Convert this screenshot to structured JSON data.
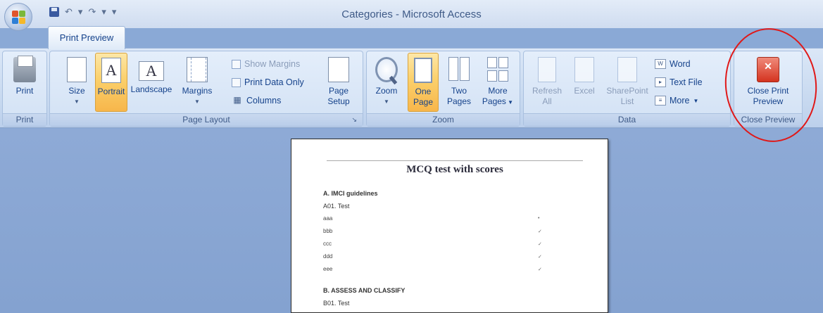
{
  "window": {
    "title": "Categories - Microsoft Access"
  },
  "quick_access": {
    "undo_glyph": "↶",
    "undo_dropdown": "▾",
    "redo_glyph": "↷",
    "redo_dropdown": "▾",
    "customize_glyph": "▾"
  },
  "tabs": [
    {
      "label": "Print Preview",
      "selected": true
    }
  ],
  "ribbon": {
    "print_group": {
      "label": "Print",
      "print_button": "Print"
    },
    "page_layout_group": {
      "label": "Page Layout",
      "size_button": "Size",
      "portrait_button": "Portrait",
      "landscape_button": "Landscape",
      "margins_button": "Margins",
      "show_margins": "Show Margins",
      "print_data_only": "Print Data Only",
      "columns": "Columns",
      "page_setup_line1": "Page",
      "page_setup_line2": "Setup",
      "portrait_glyph": "A",
      "landscape_glyph": "A"
    },
    "zoom_group": {
      "label": "Zoom",
      "zoom_button": "Zoom",
      "one_page_line1": "One",
      "one_page_line2": "Page",
      "two_pages_line1": "Two",
      "two_pages_line2": "Pages",
      "more_pages_line1": "More",
      "more_pages_line2": "Pages"
    },
    "data_group": {
      "label": "Data",
      "refresh_line1": "Refresh",
      "refresh_line2": "All",
      "excel": "Excel",
      "sharepoint_line1": "SharePoint",
      "sharepoint_line2": "List",
      "word": "Word",
      "text_file": "Text File",
      "more": "More"
    },
    "close_group": {
      "label": "Close Preview",
      "close_line1": "Close Print",
      "close_line2": "Preview",
      "close_glyph": "✕"
    }
  },
  "report": {
    "title": "MCQ test with scores",
    "section_a": "A. IMCI guidelines",
    "question_a01": "A01. Test",
    "answers": [
      "aaa",
      "bbb",
      "ccc",
      "ddd",
      "eee"
    ],
    "marks": [
      "•",
      "✓",
      "✓",
      "✓",
      "✓"
    ],
    "section_b": "B. ASSESS AND CLASSIFY",
    "question_b01": "B01. Test"
  },
  "colors": {
    "annotation": "#e01818",
    "workspace": "#8aa9d6",
    "active_button": "#fbd06b"
  }
}
